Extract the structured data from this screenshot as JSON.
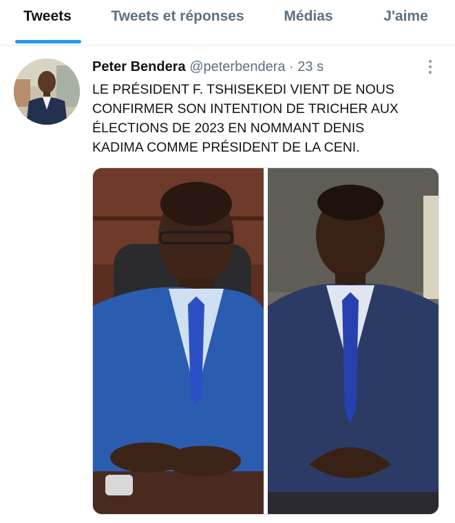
{
  "tabs": [
    {
      "label": "Tweets",
      "active": true
    },
    {
      "label": "Tweets et réponses",
      "active": false
    },
    {
      "label": "Médias",
      "active": false
    },
    {
      "label": "J'aime",
      "active": false
    }
  ],
  "tweet": {
    "author_name": "Peter Bendera",
    "handle": "@peterbendera",
    "separator": "·",
    "time": "23 s",
    "text_lines": [
      "LE PRÉSIDENT F. TSHISEKEDI VIENT DE NOUS",
      "CONFIRMER SON INTENTION DE TRICHER AUX",
      "ÉLECTIONS DE 2023 EN NOMMANT DENIS",
      "KADIMA COMME PRÉSIDENT DE LA CENI."
    ],
    "more_icon": "more-vertical-icon"
  },
  "colors": {
    "accent": "#1d9bf0",
    "secondary_text": "#5b7083",
    "primary_text": "#0f1419",
    "divider": "#e6ecf0"
  }
}
